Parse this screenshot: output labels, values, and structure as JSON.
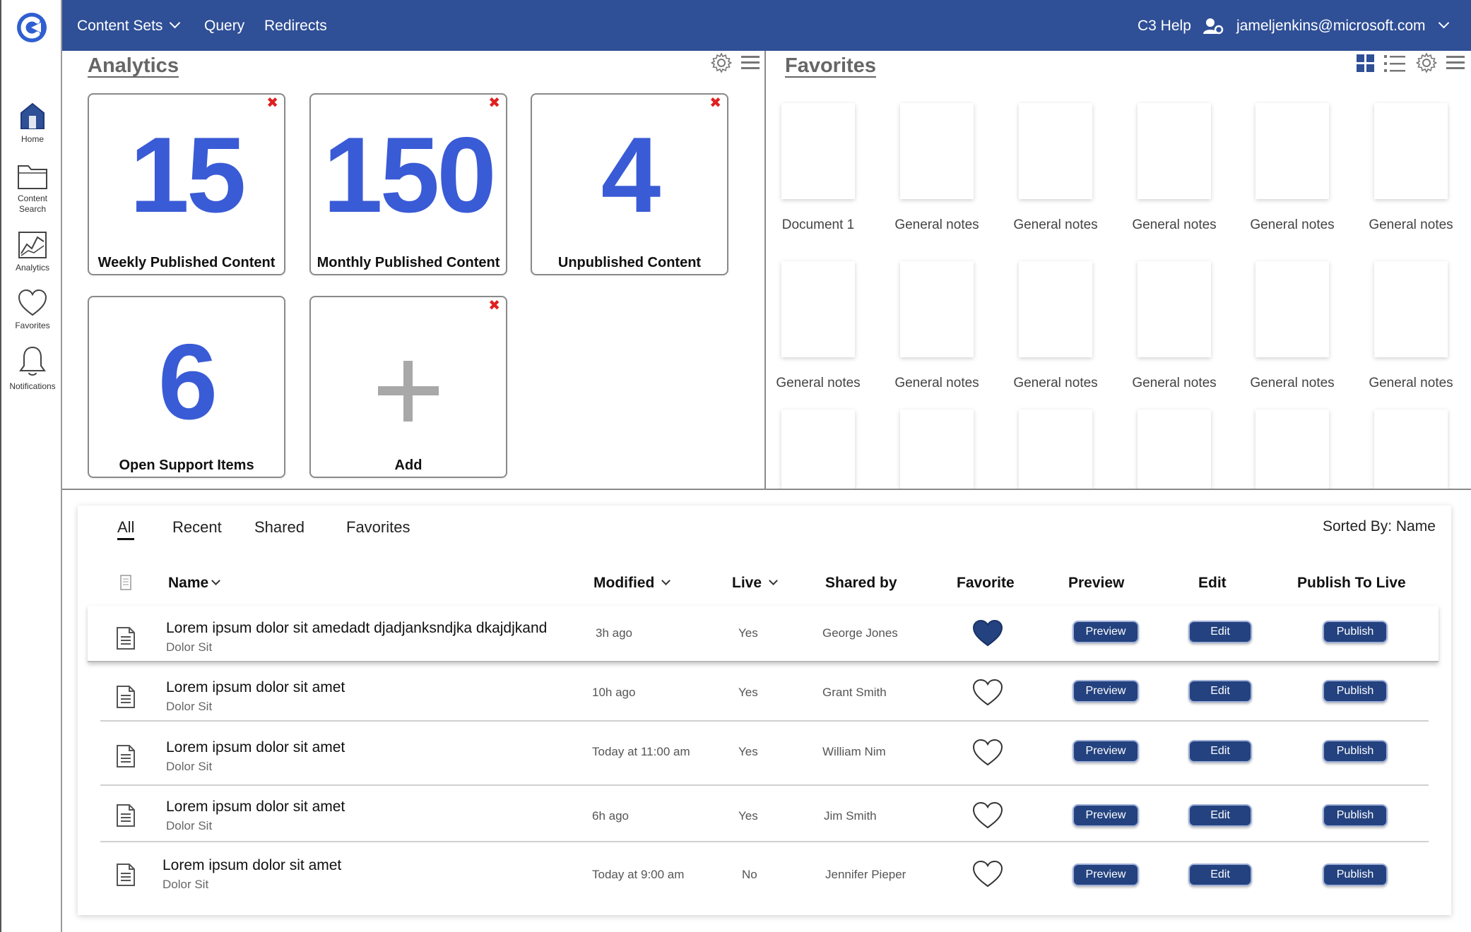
{
  "topbar": {
    "menu": [
      "Content Sets",
      "Query",
      "Redirects"
    ],
    "help": "C3 Help",
    "user_email": "jameljenkins@microsoft.com",
    "color": "#2f4f96"
  },
  "leftnav": {
    "items": [
      {
        "label": "Home",
        "icon": "home-icon"
      },
      {
        "label": "Content\nSearch",
        "icon": "folder-icon"
      },
      {
        "label": "Analytics",
        "icon": "chart-icon"
      },
      {
        "label": "Favorites",
        "icon": "heart-icon"
      },
      {
        "label": "Notifications",
        "icon": "bell-icon"
      }
    ]
  },
  "analytics": {
    "title": "Analytics",
    "tiles": [
      {
        "value": "15",
        "label": "Weekly Published Content",
        "removable": true
      },
      {
        "value": "150",
        "label": "Monthly Published Content",
        "removable": true
      },
      {
        "value": "4",
        "label": "Unpublished Content",
        "removable": true
      },
      {
        "value": "6",
        "label": "Open Support Items",
        "removable": false
      },
      {
        "value": "",
        "label": "Add",
        "removable": true
      }
    ],
    "accent": "#3a5bd6"
  },
  "favorites": {
    "title": "Favorites",
    "rows": [
      [
        "Document 1",
        "General notes",
        "General notes",
        "General notes",
        "General notes",
        "General notes"
      ],
      [
        "General notes",
        "General notes",
        "General notes",
        "General notes",
        "General notes",
        "General notes"
      ]
    ],
    "partial_row_count": 6
  },
  "list": {
    "tabs": [
      "All",
      "Recent",
      "Shared",
      "Favorites"
    ],
    "active_tab": "All",
    "sorted_by": "Sorted By: Name",
    "columns": {
      "name": "Name",
      "modified": "Modified",
      "live": "Live",
      "shared_by": "Shared by",
      "favorite": "Favorite",
      "preview": "Preview",
      "edit": "Edit",
      "publish": "Publish To Live"
    },
    "rows": [
      {
        "title": "Lorem ipsum dolor sit amedadt djadjanksndjka dkajdjkand",
        "sub": "Dolor Sit",
        "modified": "3h ago",
        "live": "Yes",
        "shared_by": "George Jones",
        "favorite": true
      },
      {
        "title": "Lorem ipsum dolor sit amet",
        "sub": "Dolor Sit",
        "modified": "10h ago",
        "live": "Yes",
        "shared_by": "Grant Smith",
        "favorite": false
      },
      {
        "title": "Lorem ipsum dolor sit amet",
        "sub": "Dolor Sit",
        "modified": "Today at 11:00 am",
        "live": "Yes",
        "shared_by": "William Nim",
        "favorite": false
      },
      {
        "title": "Lorem ipsum dolor sit amet",
        "sub": "Dolor Sit",
        "modified": "6h ago",
        "live": "Yes",
        "shared_by": "Jim Smith",
        "favorite": false
      },
      {
        "title": "Lorem ipsum dolor sit amet",
        "sub": "Dolor Sit",
        "modified": "Today at 9:00 am",
        "live": "No",
        "shared_by": "Jennifer Pieper",
        "favorite": false
      }
    ],
    "button_labels": {
      "preview": "Preview",
      "edit": "Edit",
      "publish": "Publish"
    },
    "button_color": "#23427f"
  }
}
